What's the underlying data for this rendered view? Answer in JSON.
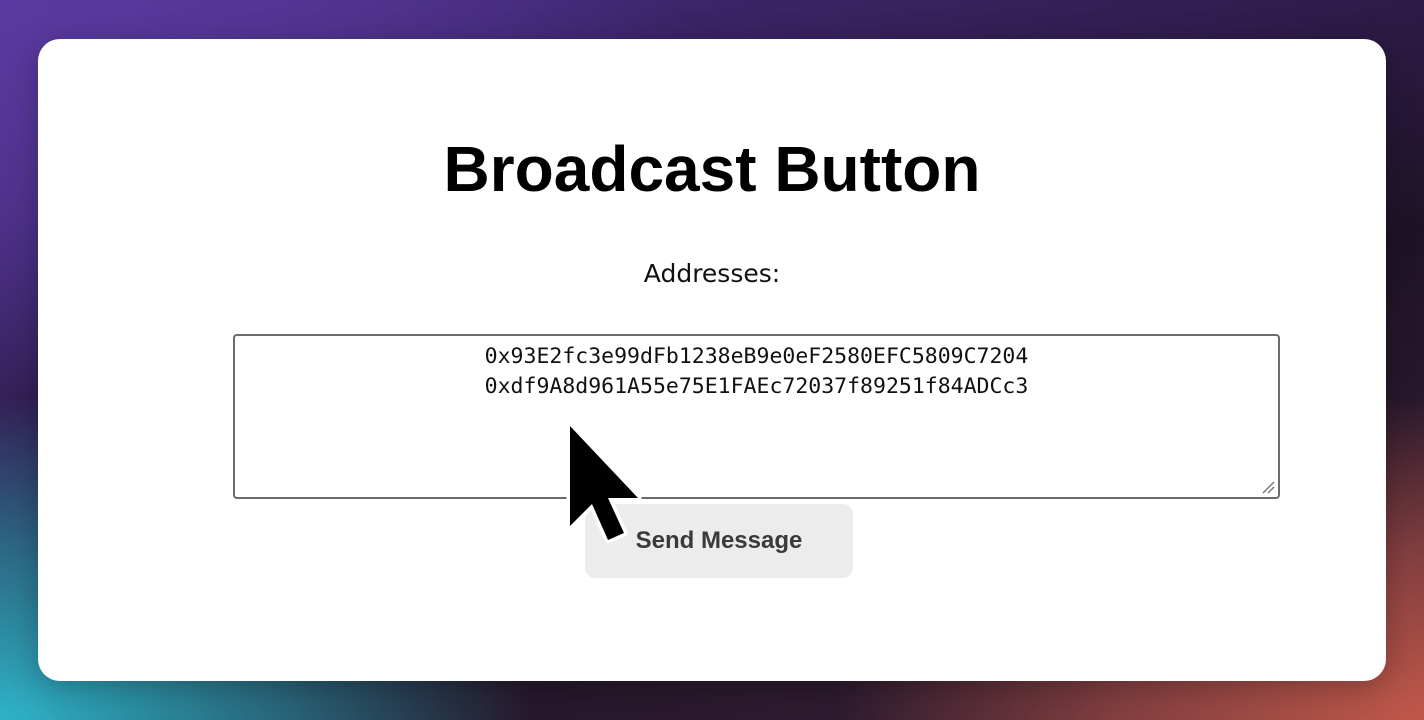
{
  "page": {
    "title": "Broadcast Button",
    "addresses_label": "Addresses:",
    "addresses_value": "0x93E2fc3e99dFb1238eB9e0eF2580EFC5809C7204\n0xdf9A8d961A55e75E1FAEc72037f89251f84ADCc3",
    "send_button_label": "Send Message"
  },
  "icons": {
    "cursor": "mouse-pointer-icon",
    "resize": "resize-grip-icon"
  },
  "colors": {
    "card_background": "#ffffff",
    "button_background": "#ececec",
    "button_text": "#3a3a3a",
    "textarea_border": "#6b6b6b"
  }
}
